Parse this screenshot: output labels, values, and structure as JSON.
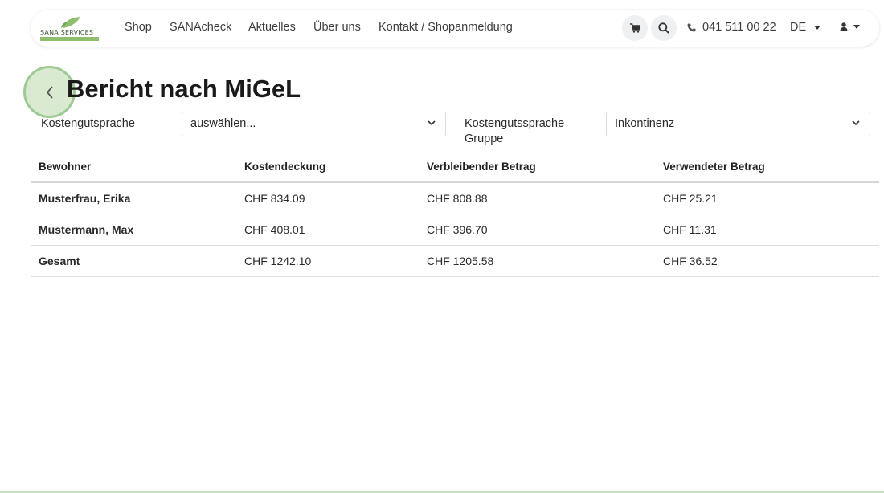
{
  "logo": {
    "text": "SANA SERVICES",
    "icon": "leaf-logo-icon"
  },
  "nav": {
    "links": [
      {
        "label": "Shop"
      },
      {
        "label": "SANAcheck"
      },
      {
        "label": "Aktuelles"
      },
      {
        "label": "Über uns"
      },
      {
        "label": "Kontakt / Shopanmeldung"
      }
    ],
    "phone": "041 511 00 22",
    "language": "DE"
  },
  "page": {
    "title": "Bericht nach MiGeL"
  },
  "filters": {
    "kostengutsprache_label": "Kostengutsprache",
    "kostengutsprache_value": "auswählen...",
    "gruppe_label": "Kostengutssprache Gruppe",
    "gruppe_value": "Inkontinenz"
  },
  "table": {
    "headers": [
      "Bewohner",
      "Kostendeckung",
      "Verbleibender Betrag",
      "Verwendeter Betrag"
    ],
    "rows": [
      [
        "Musterfrau, Erika",
        "CHF 834.09",
        "CHF 808.88",
        "CHF 25.21"
      ],
      [
        "Mustermann, Max",
        "CHF 408.01",
        "CHF 396.70",
        "CHF 11.31"
      ],
      [
        "Gesamt",
        "CHF 1242.10",
        "CHF 1205.58",
        "CHF 36.52"
      ]
    ]
  },
  "colors": {
    "accent_green": "#8dbf6f",
    "back_button_bg": "#d9ead0"
  }
}
